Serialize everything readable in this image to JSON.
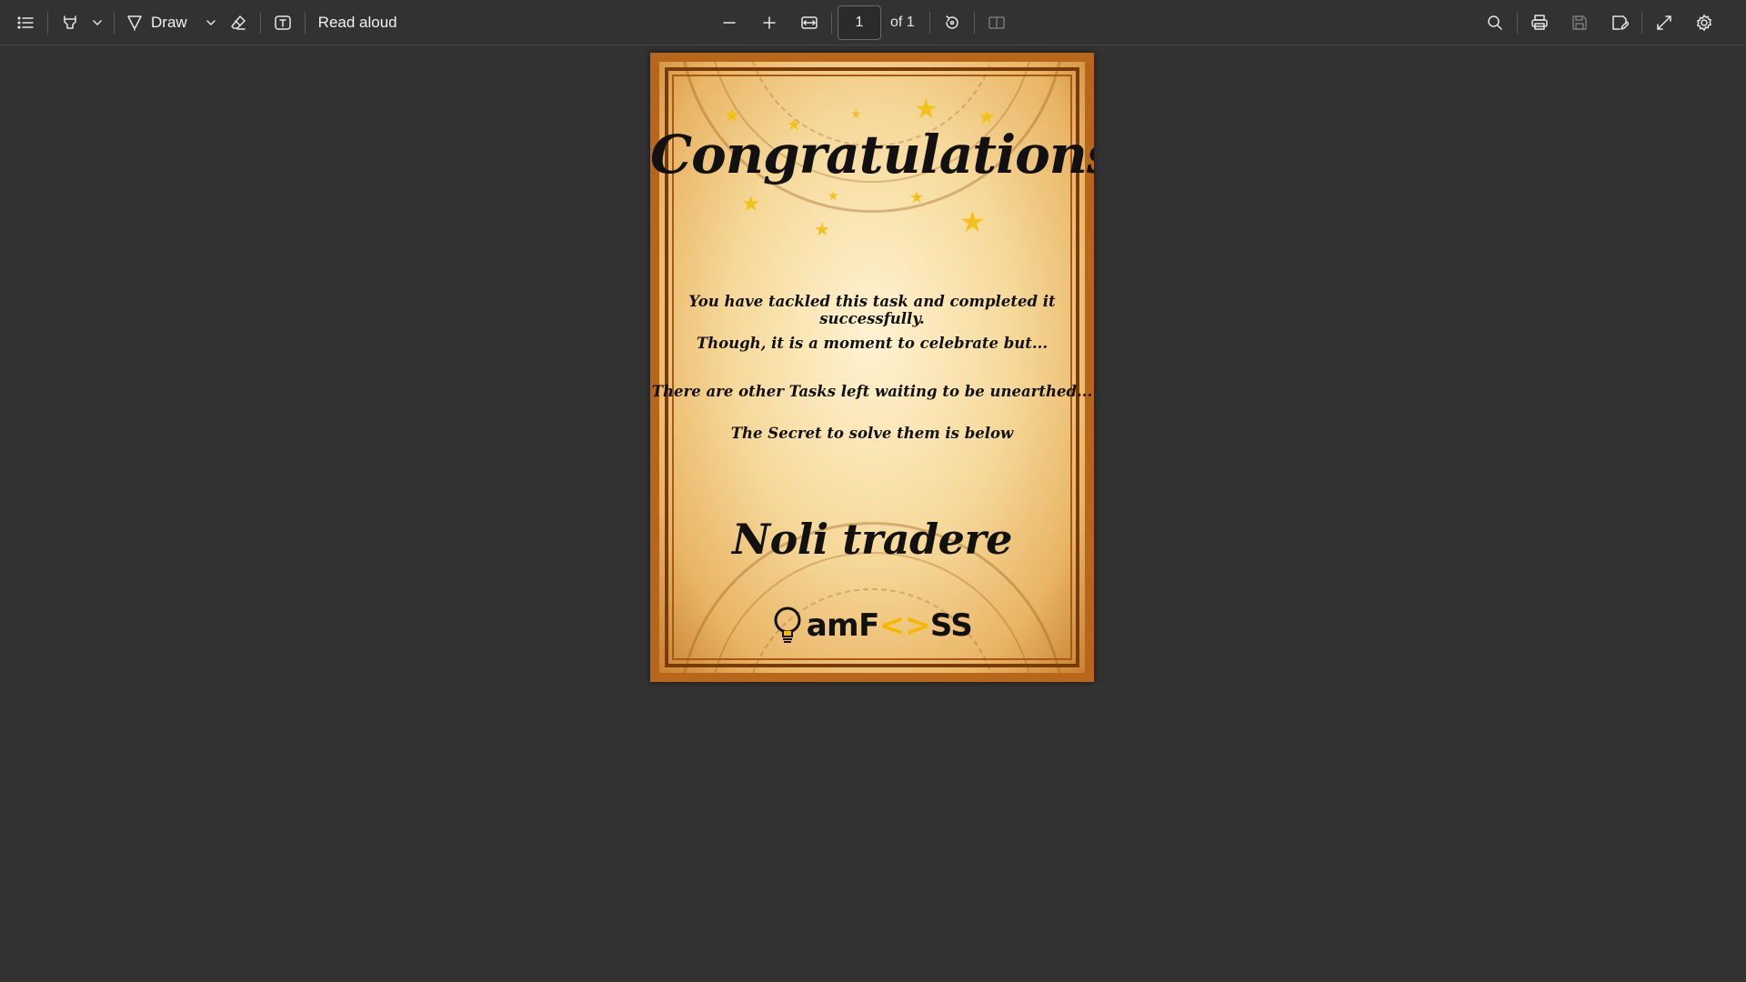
{
  "toolbar": {
    "draw_label": "Draw",
    "read_aloud_label": "Read aloud",
    "page_current": "1",
    "page_total_label": "of 1"
  },
  "icons": {
    "contents": "list-icon",
    "highlight": "highlighter-icon",
    "draw": "pen-icon",
    "erase": "eraser-icon",
    "text": "text-box-icon",
    "zoom_out": "minus-icon",
    "zoom_in": "plus-icon",
    "fit": "fit-width-icon",
    "rotate": "rotate-icon",
    "page_view": "two-page-icon",
    "search": "search-icon",
    "print": "print-icon",
    "save": "save-icon",
    "save_as": "save-as-icon",
    "fullscreen": "expand-icon",
    "settings": "gear-icon"
  },
  "certificate": {
    "title": "Congratulations!",
    "line1": "You have tackled this task and completed it successfully.",
    "line2": "Though, it is a moment to celebrate but...",
    "line3": "There are other Tasks left waiting to be unearthed...",
    "line4": "The Secret to solve them is below",
    "motto": "Noli tradere",
    "logo_part1": "amF",
    "logo_part2": "<>",
    "logo_part3": "SS"
  },
  "colors": {
    "background": "#323232",
    "star": "#f2c21c",
    "logo_accent": "#f5b800"
  }
}
